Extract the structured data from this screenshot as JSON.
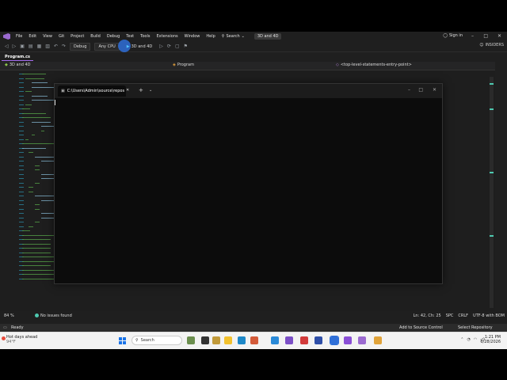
{
  "menubar": {
    "items": [
      "File",
      "Edit",
      "View",
      "Git",
      "Project",
      "Build",
      "Debug",
      "Test",
      "Tools",
      "Extensions",
      "Window",
      "Help"
    ],
    "search_label": "Search",
    "solution_name": "3D and 4D",
    "sign_in": "Sign in"
  },
  "toolbar": {
    "config": "Debug",
    "platform": "Any CPU",
    "run_target": "3D and 4D",
    "insiders": "INSIDERS"
  },
  "tabs": {
    "active_doc": "Program.cs"
  },
  "navbar": {
    "project": "3D and 4D",
    "class": "Program",
    "member": "<top-level-statements-entry-point>"
  },
  "editor_status": {
    "zoom": "84 %",
    "issues": "No issues found",
    "position": "Ln: 42, Ch: 25",
    "spacing": "SPC",
    "line_ending": "CRLF",
    "encoding": "UTF-8 with BOM"
  },
  "statusbar": {
    "ready": "Ready",
    "add_source_control": "Add to Source Control",
    "select_repository": "Select Repository"
  },
  "terminal": {
    "tab_title": "C:\\Users\\Admin\\source\\repos",
    "new_tab": "+",
    "dropdown": "⌄"
  },
  "taskbar": {
    "weather_title": "Hot days ahead",
    "weather_temp": "94°F",
    "search_label": "Search",
    "time": "1:21 PM",
    "date": "6/28/2026"
  },
  "colors": {
    "accent": "#a56cf0",
    "ide_bg": "#1f1f1f",
    "editor_bg": "#1e1e1e",
    "terminal_bg": "#0c0c0c",
    "comment_green": "#57a64a",
    "taskbar_bg": "#f3f3f3"
  }
}
